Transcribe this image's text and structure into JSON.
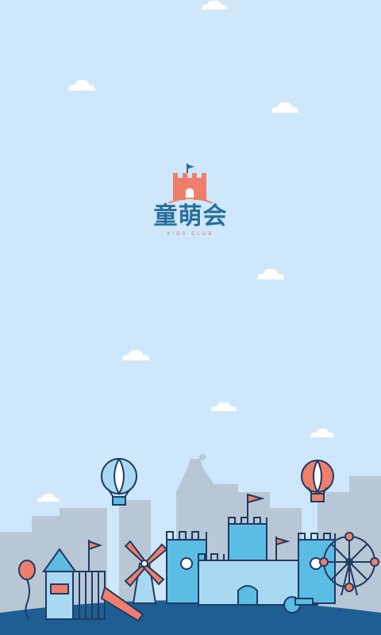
{
  "app": {
    "title": "童萌会",
    "subtitle": "KIDS CLUB"
  },
  "colors": {
    "sky": "#cfe7fb",
    "brand_coral": "#ef7f6c",
    "brand_blue": "#2a6f9c",
    "castle_blue": "#5bbde3",
    "outline": "#1f3b63",
    "city_silhouette": "#b7c7d6"
  },
  "icons": [
    "cloud-icon",
    "castle-logo-icon",
    "hot-air-balloon-icon",
    "windmill-icon",
    "ferris-wheel-icon",
    "playground-slide-icon",
    "balloon-icon",
    "flag-icon"
  ]
}
